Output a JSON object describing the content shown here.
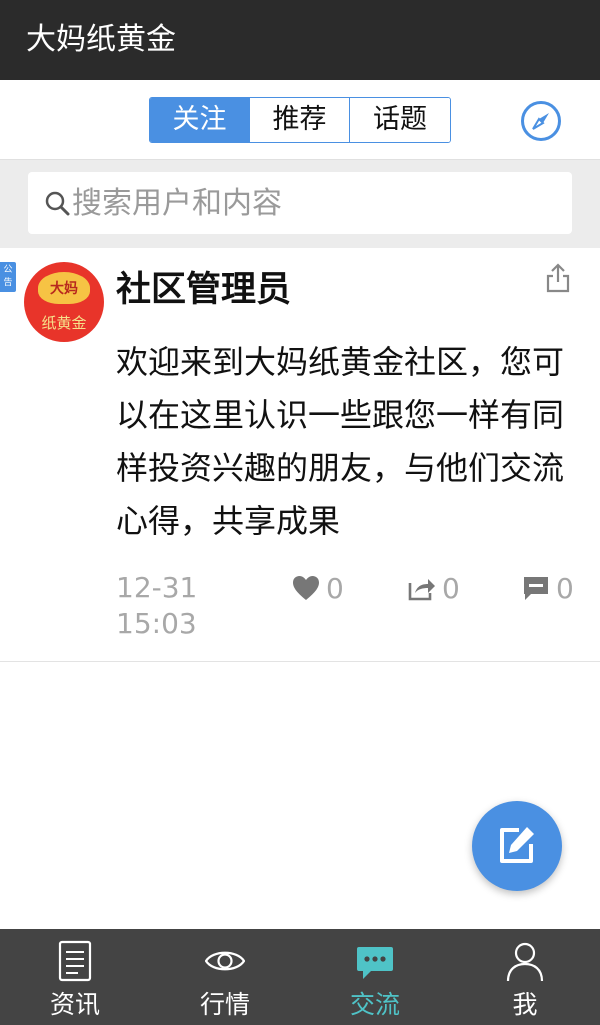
{
  "app": {
    "title": "大妈纸黄金"
  },
  "tabs": [
    {
      "label": "关注",
      "active": true
    },
    {
      "label": "推荐",
      "active": false
    },
    {
      "label": "话题",
      "active": false
    }
  ],
  "search": {
    "placeholder": "搜索用户和内容",
    "value": ""
  },
  "post": {
    "badge": "公告",
    "avatar_text_top": "大妈",
    "avatar_text_bottom": "纸黄金",
    "author": "社区管理员",
    "content": "欢迎来到大妈纸黄金社区，您可以在这里认识一些跟您一样有同样投资兴趣的朋友，与他们交流心得，共享成果",
    "time_date": "12-31",
    "time_clock": "15:03",
    "likes": "0",
    "shares": "0",
    "comments": "0"
  },
  "bottom_nav": [
    {
      "label": "资讯",
      "icon": "document-icon",
      "active": false
    },
    {
      "label": "行情",
      "icon": "eye-icon",
      "active": false
    },
    {
      "label": "交流",
      "icon": "chat-icon",
      "active": true
    },
    {
      "label": "我",
      "icon": "person-icon",
      "active": false
    }
  ],
  "colors": {
    "accent": "#4a90e2",
    "titlebar": "#2b2b2b",
    "nav_bg": "#444444",
    "nav_active": "#4fc3c7",
    "avatar_bg": "#e8342a"
  }
}
